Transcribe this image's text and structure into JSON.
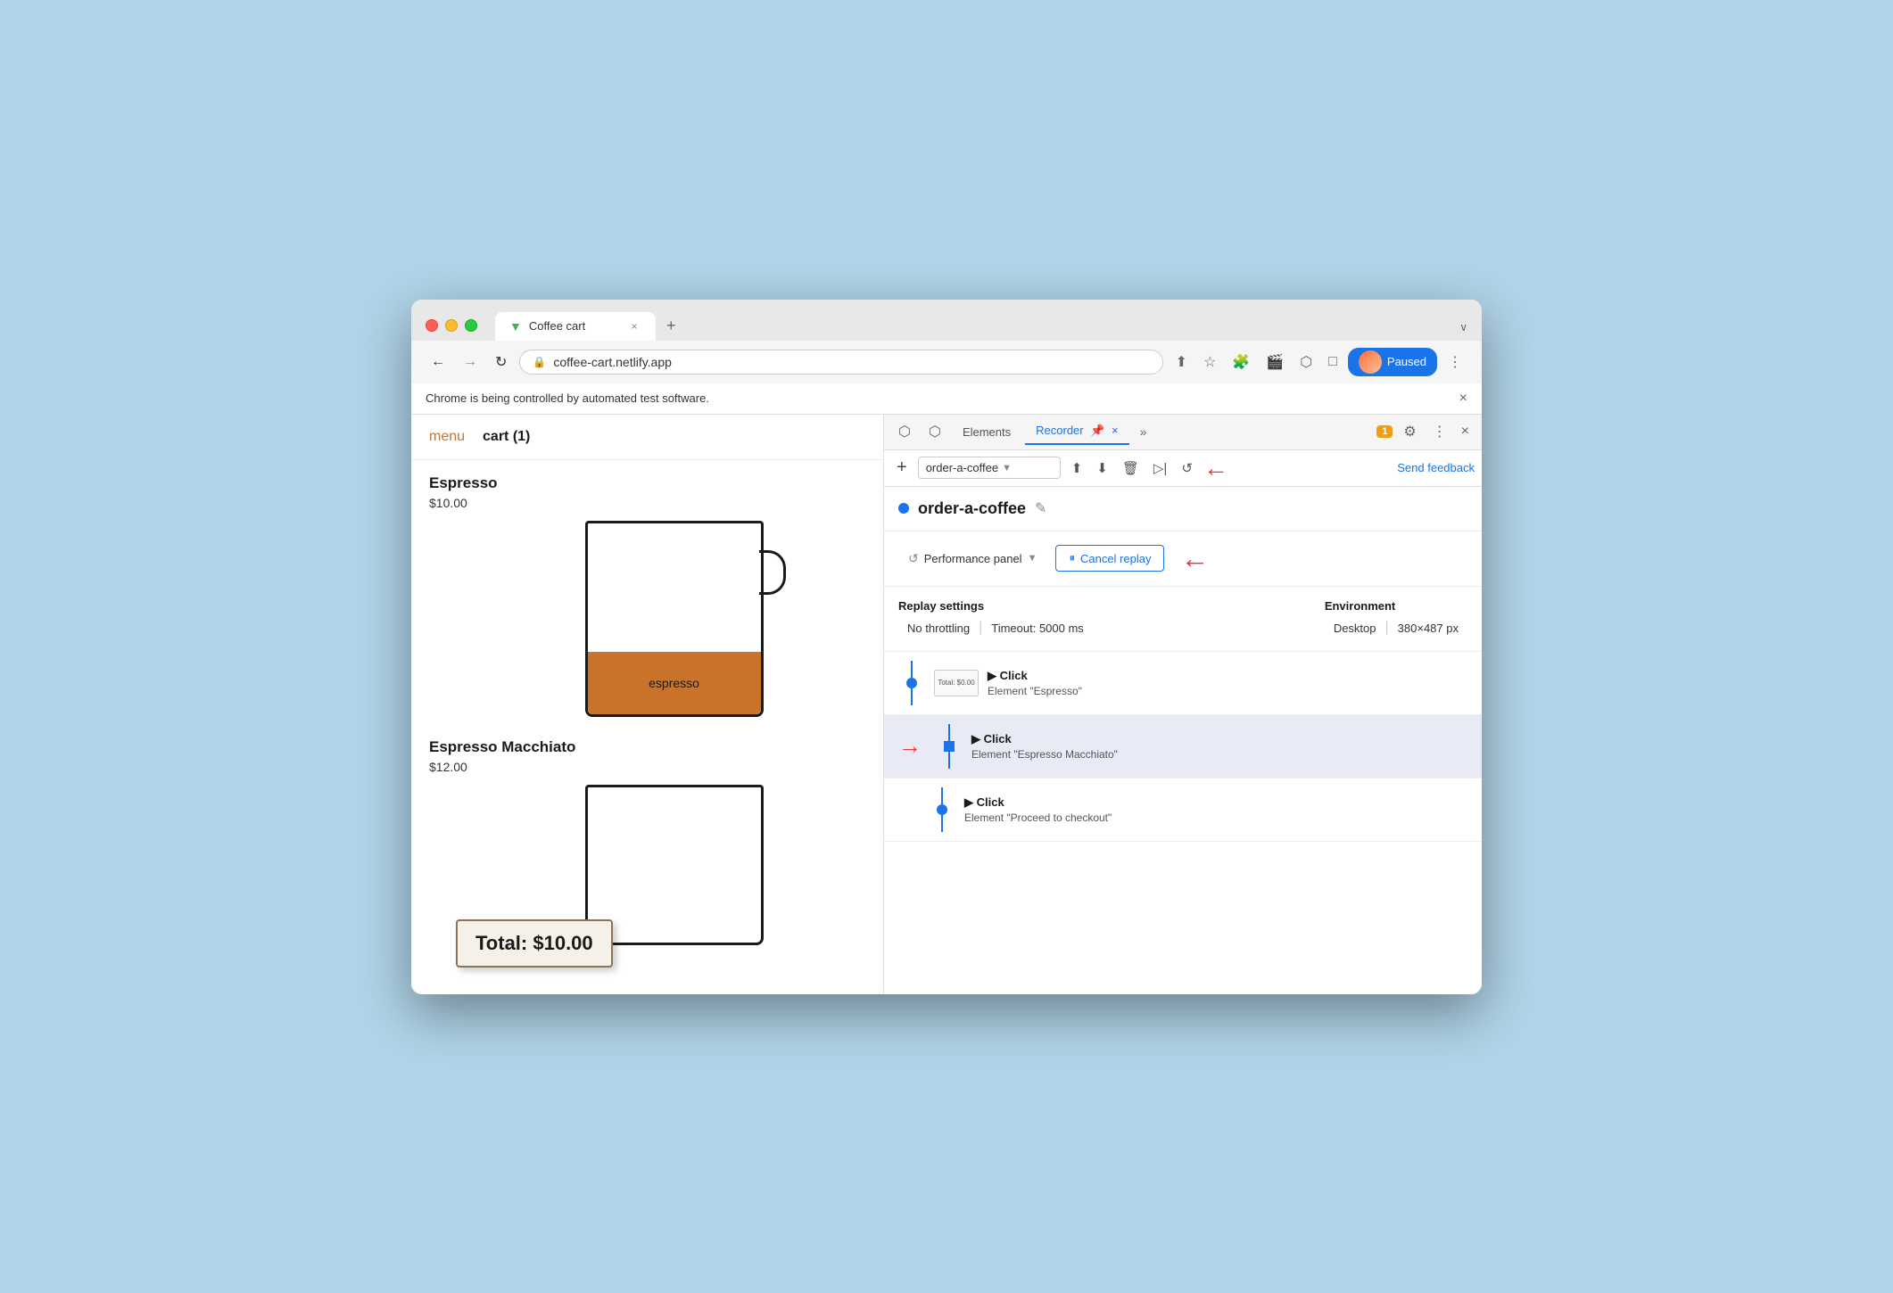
{
  "browser": {
    "tab_favicon": "▼",
    "tab_title": "Coffee cart",
    "tab_close": "×",
    "tab_new": "+",
    "tab_menu": "∨",
    "url": "coffee-cart.netlify.app",
    "back_btn": "←",
    "forward_btn": "→",
    "reload_btn": "↻",
    "paused_label": "Paused",
    "more_btn": "⋮"
  },
  "automation_banner": {
    "text": "Chrome is being controlled by automated test software.",
    "close": "×"
  },
  "app": {
    "nav_menu": "menu",
    "nav_cart": "cart (1)",
    "product1_name": "Espresso",
    "product1_price": "$10.00",
    "coffee_label": "espresso",
    "product2_name": "Espresso Macchiato",
    "product2_price": "$12.00",
    "total": "Total: $10.00"
  },
  "devtools": {
    "tabs": [
      "Elements",
      "Recorder",
      "»"
    ],
    "recorder_tab": "Recorder",
    "recorder_pin": "📌",
    "recorder_close_tab": "×",
    "badge_count": "1",
    "settings_icon": "⚙",
    "more_icon": "⋮",
    "close_icon": "×",
    "cursor_icon": "⬡",
    "window_icon": "⬡"
  },
  "recorder": {
    "add_btn": "+",
    "select_value": "order-a-coffee",
    "send_feedback": "Send feedback",
    "recording_name": "order-a-coffee",
    "edit_icon": "✎",
    "perf_panel": "Performance panel",
    "cancel_replay": "Cancel replay",
    "cancel_icon": "⏸",
    "settings_label": "Replay settings",
    "no_throttling": "No throttling",
    "timeout": "Timeout: 5000 ms",
    "environment_label": "Environment",
    "desktop": "Desktop",
    "resolution": "380×487 px",
    "steps": [
      {
        "id": 1,
        "action": "Click",
        "description": "Element \"Espresso\"",
        "thumbnail": "Total: $0.00",
        "has_arrow": false,
        "highlighted": false,
        "node_type": "circle"
      },
      {
        "id": 2,
        "action": "Click",
        "description": "Element \"Espresso Macchiato\"",
        "thumbnail": null,
        "has_arrow": true,
        "highlighted": true,
        "node_type": "square"
      },
      {
        "id": 3,
        "action": "Click",
        "description": "Element \"Proceed to checkout\"",
        "thumbnail": null,
        "has_arrow": false,
        "highlighted": false,
        "node_type": "circle"
      }
    ]
  }
}
